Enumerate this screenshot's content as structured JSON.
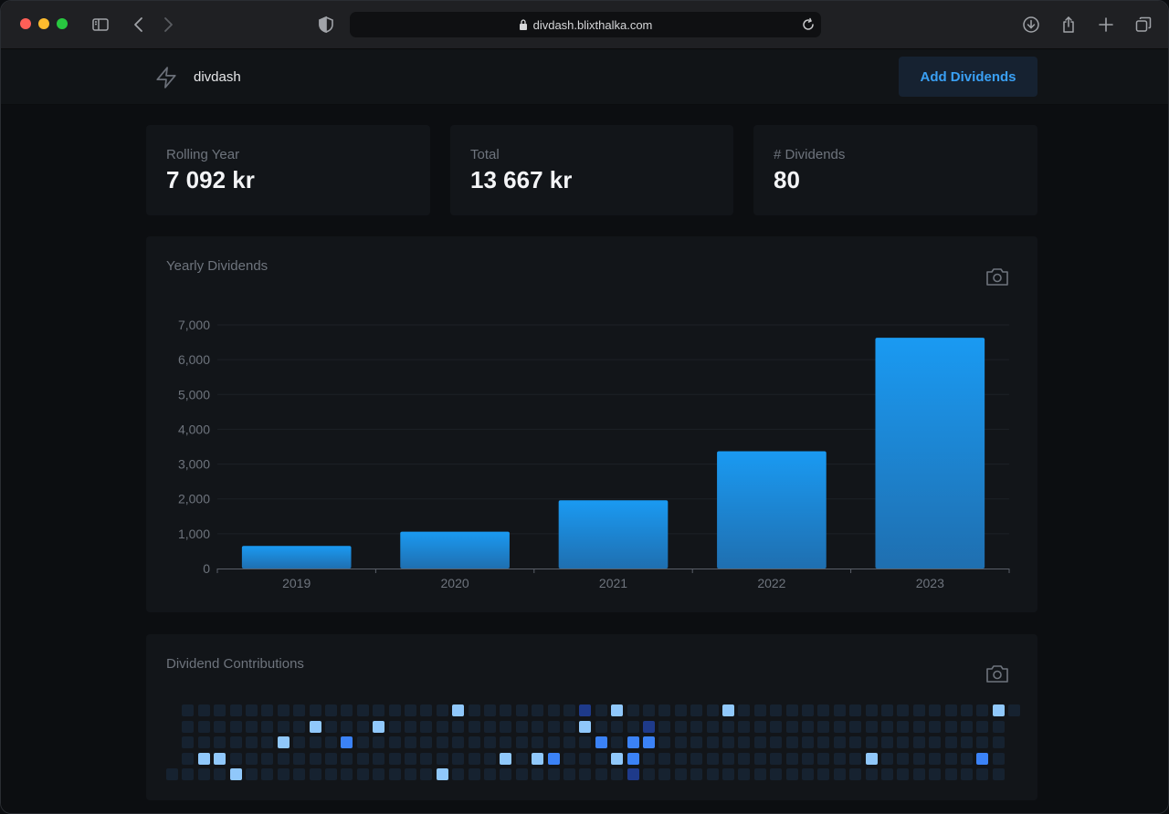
{
  "browser": {
    "url": "divdash.blixthalka.com"
  },
  "app": {
    "brand": "divdash",
    "add_button": "Add Dividends"
  },
  "stats": [
    {
      "label": "Rolling Year",
      "value": "7 092 kr"
    },
    {
      "label": "Total",
      "value": "13 667 kr"
    },
    {
      "label": "# Dividends",
      "value": "80"
    }
  ],
  "yearly": {
    "title": "Yearly Dividends"
  },
  "contributions": {
    "title": "Dividend Contributions"
  },
  "colors": {
    "bar_top": "#1a9af2",
    "bar_bottom": "#1f6fb0",
    "cell_empty": "#162230",
    "cell_light": "#90c8fb",
    "cell_mid": "#3b82f6",
    "cell_dark": "#1e3a8a"
  },
  "icons": [
    "sidebar-icon",
    "back-icon",
    "forward-icon",
    "shield-icon",
    "lock-icon",
    "reload-icon",
    "download-icon",
    "share-icon",
    "new-tab-icon",
    "tabs-icon",
    "bolt-icon",
    "camera-icon"
  ],
  "chart_data": {
    "type": "bar",
    "title": "Yearly Dividends",
    "categories": [
      "2019",
      "2020",
      "2021",
      "2022",
      "2023"
    ],
    "values": [
      650,
      1060,
      1960,
      3370,
      6630
    ],
    "ylim": [
      0,
      7000
    ],
    "yticks": [
      "0",
      "1,000",
      "2,000",
      "3,000",
      "4,000",
      "5,000",
      "6,000",
      "7,000"
    ],
    "grid": true,
    "xlabel": "",
    "ylabel": ""
  },
  "heatmap": {
    "weeks": 53,
    "days": 5,
    "cells": [
      {
        "w": 18,
        "d": 0,
        "l": 1
      },
      {
        "w": 26,
        "d": 0,
        "l": 3
      },
      {
        "w": 28,
        "d": 0,
        "l": 1
      },
      {
        "w": 35,
        "d": 0,
        "l": 1
      },
      {
        "w": 52,
        "d": 0,
        "l": 1
      },
      {
        "w": 9,
        "d": 1,
        "l": 1
      },
      {
        "w": 13,
        "d": 1,
        "l": 1
      },
      {
        "w": 26,
        "d": 1,
        "l": 1
      },
      {
        "w": 30,
        "d": 1,
        "l": 3
      },
      {
        "w": 7,
        "d": 2,
        "l": 1
      },
      {
        "w": 11,
        "d": 2,
        "l": 2
      },
      {
        "w": 27,
        "d": 2,
        "l": 2
      },
      {
        "w": 29,
        "d": 2,
        "l": 2
      },
      {
        "w": 30,
        "d": 2,
        "l": 2
      },
      {
        "w": 2,
        "d": 3,
        "l": 1
      },
      {
        "w": 3,
        "d": 3,
        "l": 1
      },
      {
        "w": 21,
        "d": 3,
        "l": 1
      },
      {
        "w": 23,
        "d": 3,
        "l": 1
      },
      {
        "w": 24,
        "d": 3,
        "l": 2
      },
      {
        "w": 28,
        "d": 3,
        "l": 1
      },
      {
        "w": 29,
        "d": 3,
        "l": 2
      },
      {
        "w": 44,
        "d": 3,
        "l": 1
      },
      {
        "w": 51,
        "d": 3,
        "l": 2
      },
      {
        "w": 4,
        "d": 4,
        "l": 1
      },
      {
        "w": 17,
        "d": 4,
        "l": 1
      },
      {
        "w": 29,
        "d": 4,
        "l": 3
      }
    ]
  }
}
